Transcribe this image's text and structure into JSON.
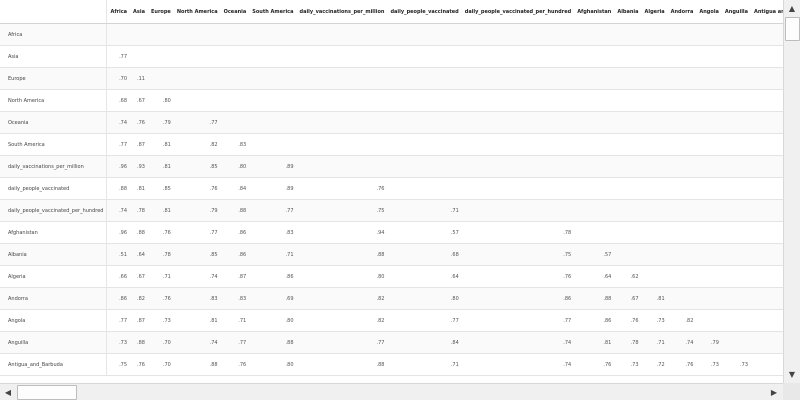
{
  "table": {
    "columns": [
      "Africa",
      "Asia",
      "Europe",
      "North America",
      "Oceania",
      "South America",
      "daily_vaccinations_per_million",
      "daily_people_vaccinated",
      "daily_people_vaccinated_per_hundred",
      "Afghanistan",
      "Albania",
      "Algeria",
      "Andorra",
      "Angola",
      "Anguilla",
      "Antigua and Barbuda"
    ],
    "rows": [
      {
        "label": "Africa",
        "values": [
          "",
          "",
          "",
          "",
          "",
          "",
          "",
          "",
          "",
          "",
          "",
          "",
          "",
          "",
          "",
          ""
        ]
      },
      {
        "label": "Asia",
        "values": [
          ".77",
          "",
          "",
          "",
          "",
          "",
          "",
          "",
          "",
          "",
          "",
          "",
          "",
          "",
          "",
          ""
        ]
      },
      {
        "label": "Europe",
        ".values": [],
        "values": [
          ".70",
          ".11",
          "",
          "",
          "",
          "",
          "",
          "",
          "",
          "",
          "",
          "",
          "",
          "",
          "",
          ""
        ]
      },
      {
        "label": "North America",
        "values": [
          ".68",
          ".67",
          ".80",
          "",
          "",
          "",
          "",
          "",
          "",
          "",
          "",
          "",
          "",
          "",
          "",
          ""
        ]
      },
      {
        "label": "Oceania",
        "values": [
          ".74",
          ".76",
          ".79",
          ".77",
          "",
          "",
          "",
          "",
          "",
          "",
          "",
          "",
          "",
          "",
          "",
          ""
        ]
      },
      {
        "label": "South America",
        "values": [
          ".77",
          ".87",
          ".81",
          ".82",
          ".83",
          "",
          "",
          "",
          "",
          "",
          "",
          "",
          "",
          "",
          "",
          ""
        ]
      },
      {
        "label": "daily_vaccinations_per_million",
        "values": [
          ".96",
          ".93",
          ".81",
          ".85",
          ".80",
          ".89",
          "",
          "",
          "",
          "",
          "",
          "",
          "",
          "",
          "",
          ""
        ]
      },
      {
        "label": "daily_people_vaccinated",
        "values": [
          ".88",
          ".81",
          ".85",
          ".76",
          ".84",
          ".89",
          ".76",
          "",
          "",
          "",
          "",
          "",
          "",
          "",
          "",
          ""
        ]
      },
      {
        "label": "daily_people_vaccinated_per_hundred",
        "values": [
          ".74",
          ".78",
          ".81",
          ".79",
          ".88",
          ".77",
          ".75",
          ".71",
          "",
          "",
          "",
          "",
          "",
          "",
          "",
          ""
        ]
      },
      {
        "label": "Afghanistan",
        "values": [
          ".96",
          ".88",
          ".76",
          ".77",
          ".86",
          ".83",
          ".94",
          ".57",
          ".78",
          "",
          "",
          "",
          "",
          "",
          "",
          ""
        ]
      },
      {
        "label": "Albania",
        "values": [
          ".51",
          ".64",
          ".78",
          ".85",
          ".86",
          ".71",
          ".88",
          ".68",
          ".75",
          ".57",
          "",
          "",
          "",
          "",
          "",
          ""
        ]
      },
      {
        "label": "Algeria",
        "values": [
          ".66",
          ".67",
          ".71",
          ".74",
          ".87",
          ".86",
          ".80",
          ".64",
          ".76",
          ".64",
          ".62",
          "",
          "",
          "",
          "",
          ""
        ]
      },
      {
        "label": "Andorra",
        "values": [
          ".86",
          ".82",
          ".76",
          ".83",
          ".83",
          ".69",
          ".82",
          ".80",
          ".86",
          ".88",
          ".67",
          ".81",
          "",
          "",
          "",
          ""
        ]
      },
      {
        "label": "Angola",
        "values": [
          ".77",
          ".87",
          ".73",
          ".81",
          ".71",
          ".80",
          ".82",
          ".77",
          ".77",
          ".86",
          ".76",
          ".73",
          ".82",
          "",
          "",
          ""
        ]
      },
      {
        "label": "Anguilla",
        "values": [
          ".73",
          ".88",
          ".70",
          ".74",
          ".77",
          ".88",
          ".77",
          ".84",
          ".74",
          ".81",
          ".78",
          ".71",
          ".74",
          ".79",
          "",
          ""
        ]
      },
      {
        "label": "Antigua_and_Barbuda",
        "values": [
          ".75",
          ".76",
          ".70",
          ".88",
          ".76",
          ".80",
          ".88",
          ".71",
          ".74",
          ".76",
          ".73",
          ".72",
          ".76",
          ".73",
          ".73",
          ""
        ]
      }
    ]
  },
  "scrollbars": {
    "up_arrow": "▲",
    "down_arrow": "▼",
    "left_arrow": "◀",
    "right_arrow": "▶"
  }
}
